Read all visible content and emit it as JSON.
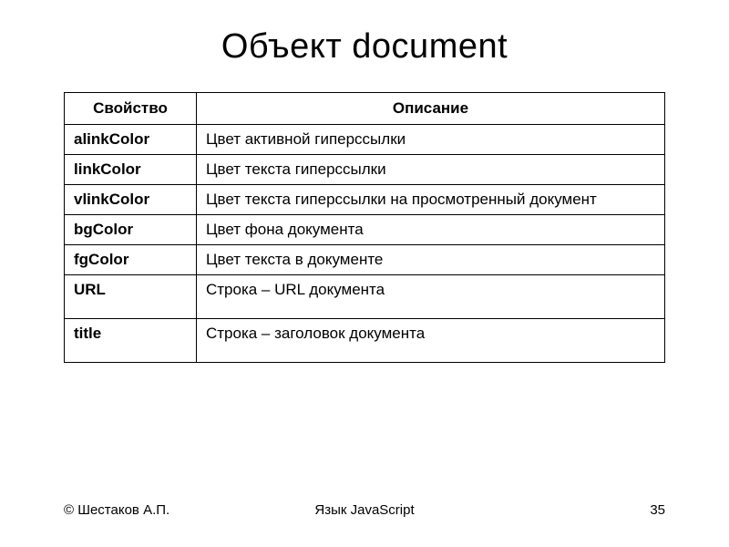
{
  "title": "Объект document",
  "table": {
    "headers": [
      "Свойство",
      "Описание"
    ],
    "rows": [
      {
        "prop": "alinkColor",
        "desc": "Цвет активной гиперссылки"
      },
      {
        "prop": "linkColor",
        "desc": "Цвет текста гиперссылки"
      },
      {
        "prop": "vlinkColor",
        "desc": "Цвет текста гиперссылки на просмотренный документ"
      },
      {
        "prop": "bgColor",
        "desc": "Цвет фона документа"
      },
      {
        "prop": "fgColor",
        "desc": "Цвет текста в документе"
      },
      {
        "prop": "URL",
        "desc": "Строка – URL документа"
      },
      {
        "prop": "title",
        "desc": "Строка – заголовок документа"
      }
    ]
  },
  "footer": {
    "left": "© Шестаков А.П.",
    "center": "Язык JavaScript",
    "right": "35"
  }
}
